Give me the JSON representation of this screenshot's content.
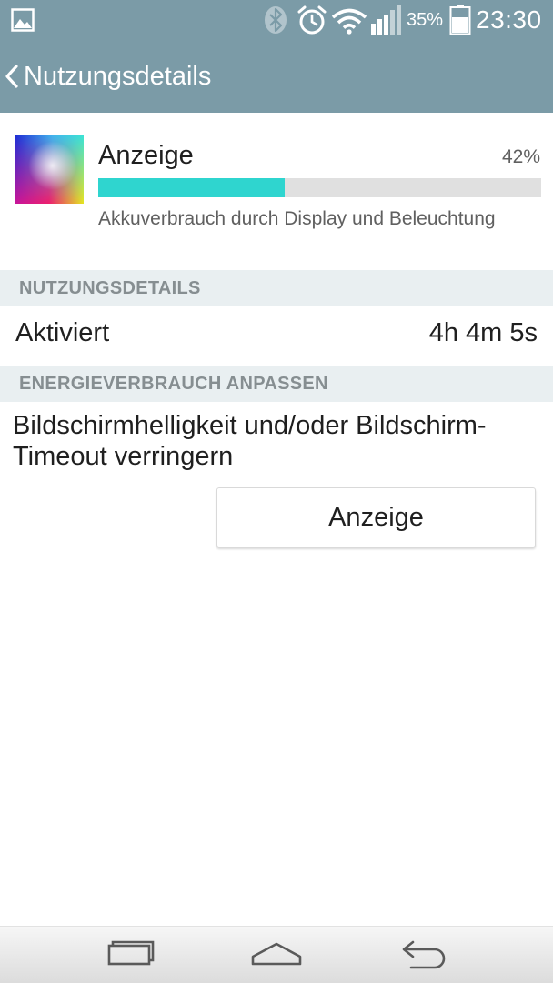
{
  "status_bar": {
    "battery_percent": "35%",
    "time": "23:30",
    "icons": [
      "gallery-icon",
      "bluetooth-icon",
      "alarm-icon",
      "wifi-icon",
      "signal-icon",
      "battery-icon"
    ]
  },
  "action_bar": {
    "title": "Nutzungsdetails",
    "back_icon": "chevron-left-icon"
  },
  "usage_item": {
    "title": "Anzeige",
    "percent_label": "42%",
    "usage_fraction": 0.42,
    "description": "Akkuverbrauch durch Display und Beleuchtung",
    "icon": "display-icon",
    "bar_color": "#2fd5cf",
    "track_color": "#e0e0e0"
  },
  "usage_details": {
    "header": "NUTZUNGSDETAILS",
    "rows": [
      {
        "label": "Aktiviert",
        "value": "4h 4m 5s"
      }
    ]
  },
  "adjust": {
    "header": "ENERGIEVERBRAUCH ANPASSEN",
    "tip": "Bildschirmhelligkeit und/oder Bildschirm-Timeout verringern",
    "button_label": "Anzeige"
  },
  "nav_bar": {
    "icons": [
      "recent-apps-icon",
      "home-icon",
      "back-icon"
    ]
  },
  "colors": {
    "accent": "#7b9ba7",
    "section_header_bg": "#e9eff1",
    "section_header_text": "#868e91"
  }
}
